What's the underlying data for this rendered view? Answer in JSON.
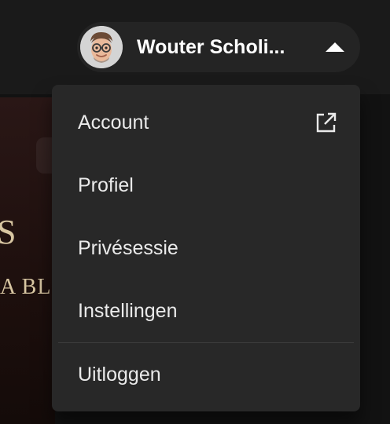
{
  "user": {
    "name": "Wouter Scholi...",
    "avatar_icon": "memoji-avatar",
    "caret_icon": "caret-up-icon"
  },
  "background": {
    "letter": "S",
    "text": "A BL"
  },
  "menu": {
    "items": [
      {
        "label": "Account",
        "icon": "external-link-icon"
      },
      {
        "label": "Profiel"
      },
      {
        "label": "Privésessie"
      },
      {
        "label": "Instellingen"
      },
      {
        "label": "Uitloggen"
      }
    ]
  },
  "colors": {
    "menu_bg": "#282828",
    "user_button_bg": "#242424",
    "text": "#eaeaea",
    "divider": "#3e3e3e"
  }
}
